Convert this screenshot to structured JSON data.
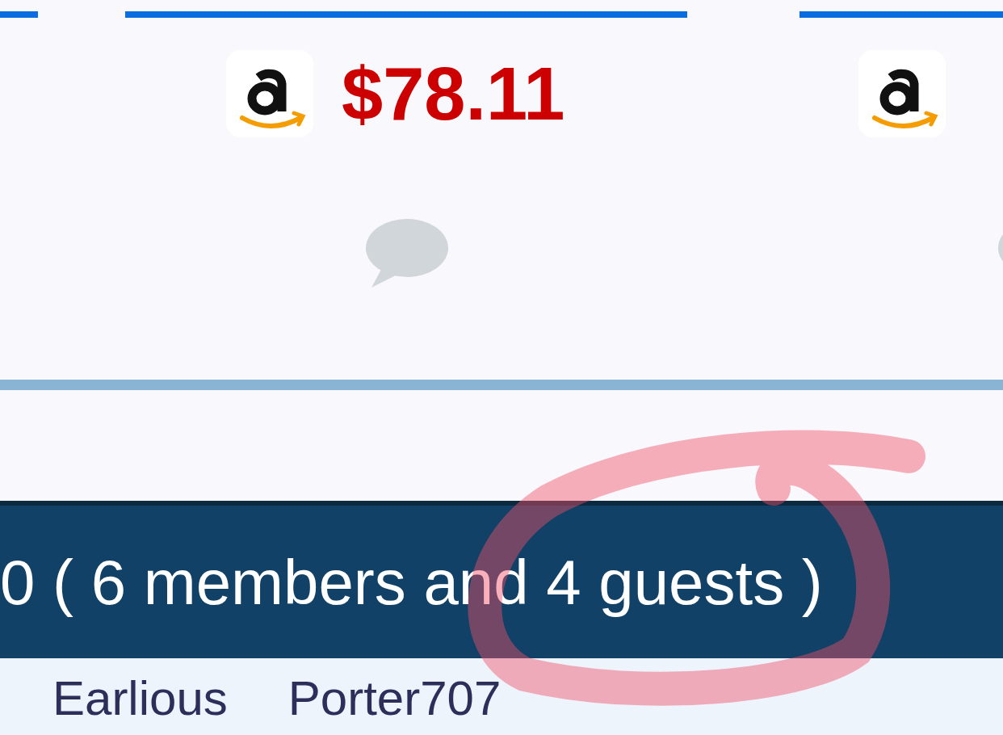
{
  "products": [
    {
      "price": "$78.11",
      "comments": true
    },
    {
      "comments": true
    }
  ],
  "online_bar": {
    "text": "0 ( 6 members and 4 guests )"
  },
  "online_users": [
    "Earlious",
    "Porter707"
  ],
  "annotation": {
    "kind": "scribble"
  }
}
